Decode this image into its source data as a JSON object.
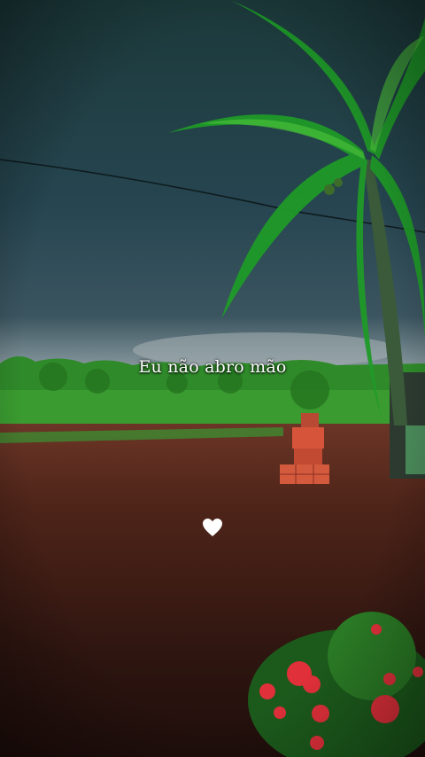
{
  "caption": {
    "text": "Eu não abro mão"
  },
  "heart": {
    "icon": "white-heart-icon",
    "color": "#ffffff"
  },
  "scene": {
    "description_icons": [
      "storm-sky",
      "palm-tree",
      "dirt-ground",
      "brick-stack",
      "red-flower-bush"
    ],
    "colors": {
      "sky_top": "#1f3f3f",
      "sky_bottom": "#2c4a55",
      "horizon_glow": "#8aa0a6",
      "treeline": "#2f8a2a",
      "grass": "#3b9b32",
      "ground_far": "#5a2f22",
      "ground_near": "#2a1410",
      "palm": "#1fa12a",
      "flowers": "#e0303a",
      "bricks": "#d6553a"
    }
  }
}
